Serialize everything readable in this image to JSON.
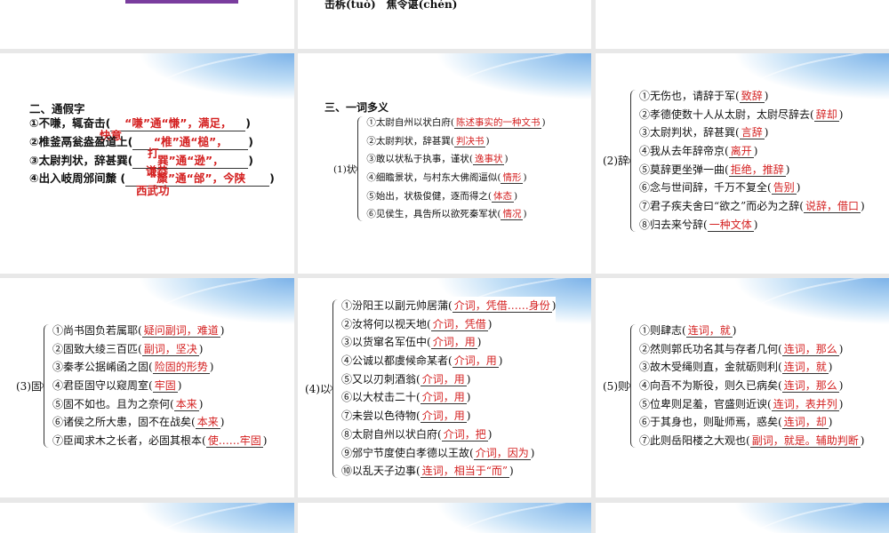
{
  "top_middle_text": "击柝(tuò)　焦令谌(chén)",
  "colors": {
    "accent_purple": "#7a3d9e",
    "answer_red": "#d42020"
  },
  "slide_tongjiazi": {
    "title": "二、通假字",
    "items": [
      {
        "text": "①不嗛，辄奋击(",
        "answer": "“嗛”通“慊”，满足，",
        "overflow": "快意",
        "close": ")"
      },
      {
        "text": "②椎釜鬲瓮盎盈道上(",
        "answer": "“椎”通“槌”，",
        "overflow": "",
        "close": ")"
      },
      {
        "text": "③太尉判状，辞甚巽(",
        "answer": "巽”通“逊”，",
        "overflow": "打",
        "close": ")"
      },
      {
        "text": "④出入岐周邠间斄 (",
        "answer": "“斄”通“邰”，今陕",
        "overflow": "谦恭",
        "close": ")",
        "overflow2": "西武功"
      }
    ]
  },
  "slide_zhuang": {
    "title": "三、一词多义",
    "label": "(1)状",
    "items": [
      {
        "text": "①太尉自州以状白府(",
        "answer": "陈述事实的一种文书",
        "close": ")"
      },
      {
        "text": "②太尉判状，辞甚巽(",
        "answer": "判决书",
        "close": ")"
      },
      {
        "text": "③敢以状私于执事，谨状(",
        "answer": "逸事状",
        "close": ")"
      },
      {
        "text": "④细瞻景状，与村东大佛阁逼似(",
        "answer": "情形",
        "close": ")"
      },
      {
        "text": "⑤始出，状极俊健，逐而得之(",
        "answer": "体态",
        "close": ")"
      },
      {
        "text": "⑥见侯生，具告所以欲死秦军状(",
        "answer": "情况",
        "close": ")"
      }
    ]
  },
  "slide_ci": {
    "label": "(2)辞",
    "items": [
      {
        "text": "①无伤也，请辞于军(",
        "answer": "致辞",
        "close": ")"
      },
      {
        "text": "②孝德使数十人从太尉，太尉尽辞去(",
        "answer": "辞却",
        "close": ")"
      },
      {
        "text": "③太尉判状，辞甚巽(",
        "answer": "言辞",
        "close": ")"
      },
      {
        "text": "④我从去年辞帝京(",
        "answer": "离开",
        "close": ")"
      },
      {
        "text": "⑤莫辞更坐弹一曲(",
        "answer": "拒绝，推辞",
        "close": ")"
      },
      {
        "text": "⑥念与世间辞，千万不复全(",
        "answer": "告别",
        "close": ")"
      },
      {
        "text": "⑦君子疾夫舍曰“欲之”而必为之辞(",
        "answer": "说辞，借口",
        "close": ")"
      },
      {
        "text": "⑧归去来兮辞(",
        "answer": "一种文体",
        "close": ")"
      }
    ]
  },
  "slide_gu": {
    "label": "(3)固",
    "items": [
      {
        "text": "①尚书固负若属耶(",
        "answer": "疑问副词，难道",
        "close": ")"
      },
      {
        "text": "②固致大绫三百匹(",
        "answer": "副词，坚决",
        "close": ")"
      },
      {
        "text": "③秦孝公据崤函之固(",
        "answer": "险固的形势",
        "close": ")"
      },
      {
        "text": "④君臣固守以窥周室(",
        "answer": "牢固",
        "close": ")"
      },
      {
        "text": "⑤固不如也。且为之奈何(",
        "answer": "本来",
        "close": ")"
      },
      {
        "text": "⑥诸侯之所大患，固不在战矣(",
        "answer": "本来",
        "close": ")"
      },
      {
        "text": "⑦臣闻求木之长者，必固其根本(",
        "answer": "使……牢固",
        "close": ")"
      }
    ]
  },
  "slide_yi": {
    "label": "(4)以",
    "items": [
      {
        "text": "①汾阳王以副元帅居蒲(",
        "answer": "介词，凭借……身份",
        "close": ")"
      },
      {
        "text": "②汝将何以视天地(",
        "answer": "介词，凭借",
        "close": ")"
      },
      {
        "text": "③以货窜名军伍中(",
        "answer": "介词，用",
        "close": ")"
      },
      {
        "text": "④公诚以都虞候命某者(",
        "answer": "介词，用",
        "close": ")"
      },
      {
        "text": "⑤又以刃刺酒翁(",
        "answer": "介词，用",
        "close": ")"
      },
      {
        "text": "⑥以大杖击二十(",
        "answer": "介词，用",
        "close": ")"
      },
      {
        "text": "⑦未尝以色待物(",
        "answer": "介词，用",
        "close": ")"
      },
      {
        "text": "⑧太尉自州以状白府(",
        "answer": "介词，把",
        "close": ")"
      },
      {
        "text": "⑨邠宁节度使白孝德以王故(",
        "answer": "介词，因为",
        "close": ")"
      },
      {
        "text": "⑩以乱天子边事(",
        "answer": "连词，相当于“而”",
        "close": ")"
      }
    ]
  },
  "slide_ze": {
    "label": "(5)则",
    "items": [
      {
        "text": "①则肆志(",
        "answer": "连词，就",
        "close": ")"
      },
      {
        "text": "②然则郭氏功名其与存者几何(",
        "answer": "连词，那么",
        "close": ")"
      },
      {
        "text": "③故木受绳则直，金就砺则利(",
        "answer": "连词，就",
        "close": ")"
      },
      {
        "text": "④向吾不为斯役，则久已病矣(",
        "answer": "连词，那么",
        "close": ")"
      },
      {
        "text": "⑤位卑则足羞，官盛则近谀(",
        "answer": "连词，表并列",
        "close": ")"
      },
      {
        "text": "⑥于其身也，则耻师焉，惑矣(",
        "answer": "连词，却",
        "close": ")"
      },
      {
        "text": "⑦此则岳阳楼之大观也(",
        "answer": "副词，就是。辅助判断",
        "close": ")"
      }
    ]
  }
}
